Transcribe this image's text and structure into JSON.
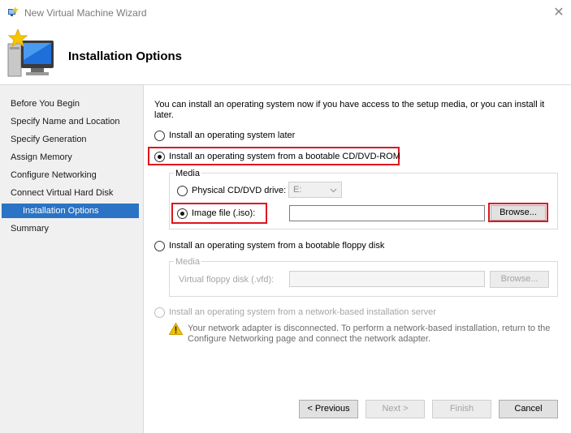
{
  "window": {
    "title": "New Virtual Machine Wizard",
    "close_glyph": "✕"
  },
  "header": {
    "title": "Installation Options"
  },
  "sidebar": {
    "items": [
      {
        "label": "Before You Begin"
      },
      {
        "label": "Specify Name and Location"
      },
      {
        "label": "Specify Generation"
      },
      {
        "label": "Assign Memory"
      },
      {
        "label": "Configure Networking"
      },
      {
        "label": "Connect Virtual Hard Disk"
      },
      {
        "label": "Installation Options"
      },
      {
        "label": "Summary"
      }
    ],
    "active_index": 6
  },
  "content": {
    "intro_line1": "You can install an operating system now if you have access to the setup media, or you can install it",
    "intro_line2": "later.",
    "option_later": "Install an operating system later",
    "option_cd": "Install an operating system from a bootable CD/DVD-ROM",
    "media_group": {
      "label": "Media",
      "physical_label": "Physical CD/DVD drive:",
      "physical_value": "E:",
      "image_label": "Image file (.iso):",
      "image_value": "",
      "browse_label": "Browse..."
    },
    "option_floppy": "Install an operating system from a bootable floppy disk",
    "floppy_group": {
      "label": "Media",
      "vfd_label": "Virtual floppy disk (.vfd):",
      "vfd_value": "",
      "browse_label": "Browse..."
    },
    "option_network": "Install an operating system from a network-based installation server",
    "warning_line1": "Your network adapter is disconnected. To perform a network-based installation, return to the",
    "warning_line2": "Configure Networking page and connect the network adapter."
  },
  "footer": {
    "previous_label": "< Previous",
    "next_label": "Next >",
    "finish_label": "Finish",
    "cancel_label": "Cancel"
  },
  "colors": {
    "accent": "#2b73c4",
    "highlight_box": "#e0141e",
    "warning": "#f2c200"
  },
  "icons": [
    "app-icon",
    "close-icon",
    "wizard-computer-icon",
    "warning-icon",
    "dropdown-chevron-icon"
  ]
}
